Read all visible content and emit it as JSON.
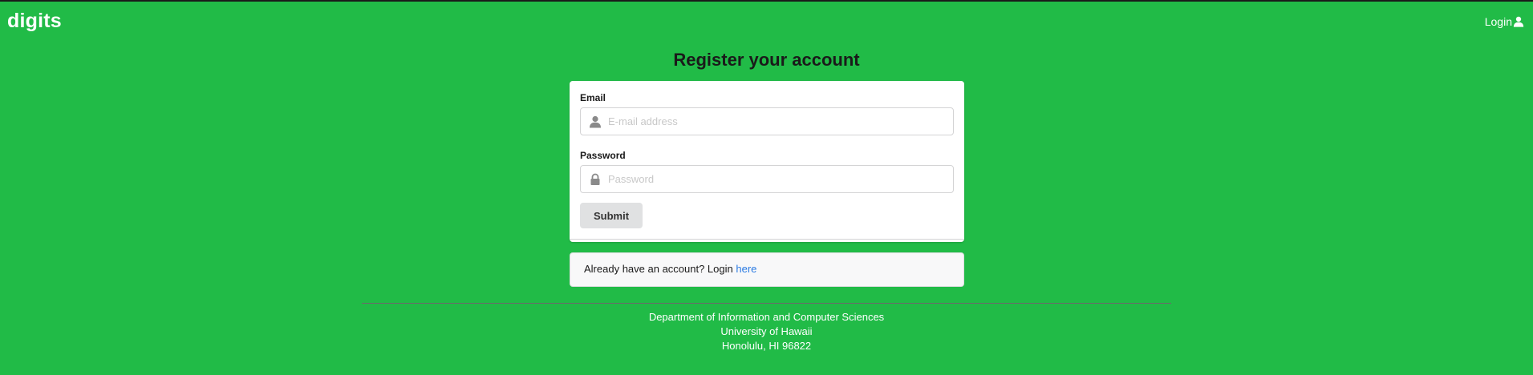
{
  "navbar": {
    "brand": "digits",
    "login_label": "Login",
    "login_icon": "user-icon"
  },
  "page": {
    "title": "Register your account"
  },
  "form": {
    "email": {
      "label": "Email",
      "placeholder": "E-mail address",
      "value": "",
      "icon": "user-icon"
    },
    "password": {
      "label": "Password",
      "placeholder": "Password",
      "value": "",
      "icon": "lock-icon"
    },
    "submit_label": "Submit"
  },
  "message": {
    "text": "Already have an account? Login ",
    "link_text": "here"
  },
  "footer": {
    "line1": "Department of Information and Computer Sciences",
    "line2": "University of Hawaii",
    "line3": "Honolulu, HI 96822"
  },
  "colors": {
    "background": "#21bb47",
    "link": "#2a7ae2",
    "button": "#e0e1e2"
  }
}
